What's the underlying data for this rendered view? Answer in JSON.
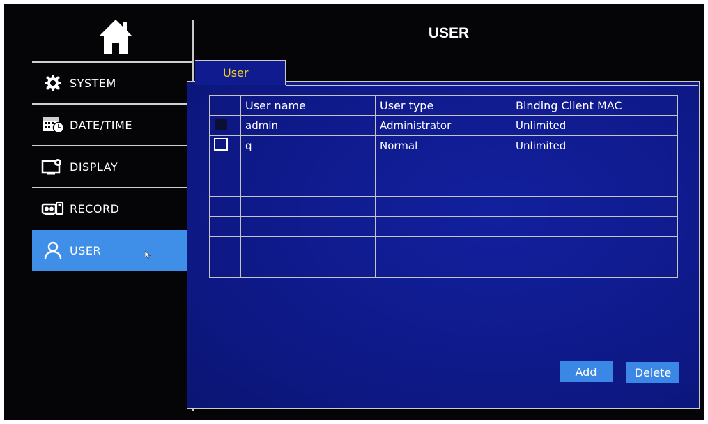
{
  "header": {
    "title": "USER"
  },
  "sidebar": {
    "items": [
      {
        "label": "SYSTEM",
        "icon": "gear-icon"
      },
      {
        "label": "DATE/TIME",
        "icon": "calendar-clock-icon"
      },
      {
        "label": "DISPLAY",
        "icon": "monitor-settings-icon"
      },
      {
        "label": "RECORD",
        "icon": "camera-record-icon"
      },
      {
        "label": "USER",
        "icon": "user-icon",
        "active": true
      }
    ]
  },
  "tab": {
    "label": "User"
  },
  "table": {
    "columns": [
      "User name",
      "User type",
      "Binding Client MAC"
    ],
    "rows": [
      {
        "name": "admin",
        "type": "Administrator",
        "mac": "Unlimited"
      },
      {
        "name": "q",
        "type": "Normal",
        "mac": "Unlimited"
      }
    ]
  },
  "buttons": {
    "add": "Add",
    "delete": "Delete"
  },
  "colors": {
    "panel": "#0f1b8f",
    "accent": "#3f8ee8",
    "tab_text": "#f0d020",
    "background": "#050507"
  }
}
